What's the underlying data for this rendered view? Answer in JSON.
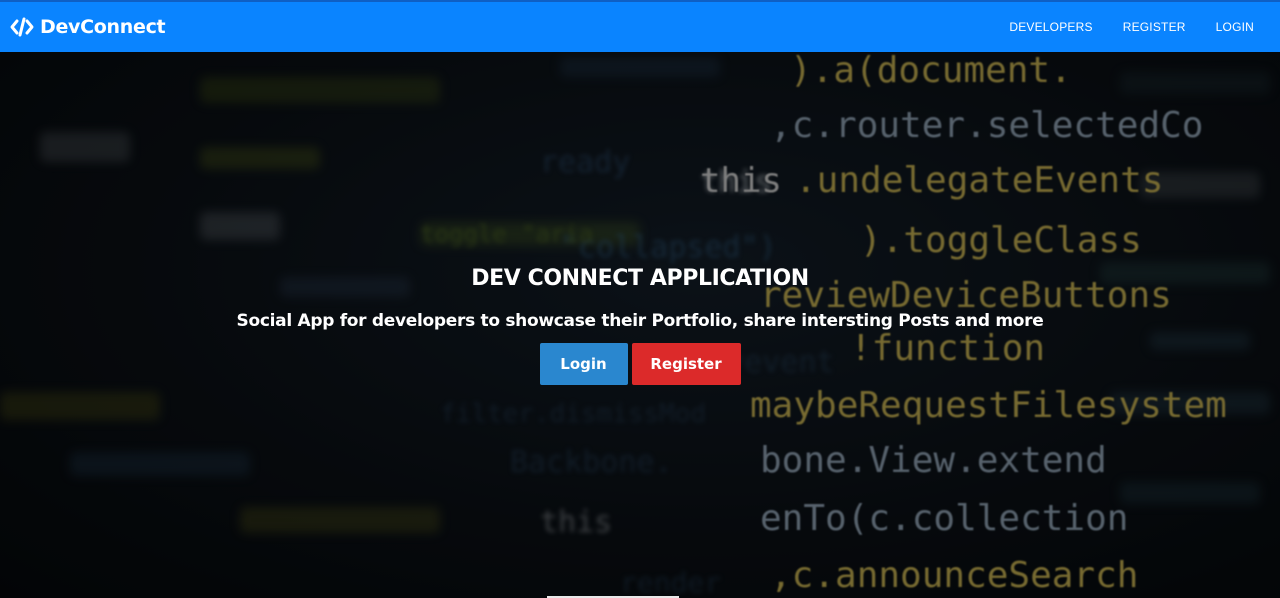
{
  "navbar": {
    "brand_icon": "code-icon",
    "brand_name": "DevConnect",
    "links": [
      "DEVELOPERS",
      "REGISTER",
      "LOGIN"
    ],
    "background_color": "#0a84ff"
  },
  "hero": {
    "title": "DEV CONNECT APPLICATION",
    "subtitle": "Social App for developers to showcase their Portfolio, share intersting Posts and more",
    "buttons": {
      "login_label": "Login",
      "register_label": "Register"
    },
    "login_color": "#2a87cf",
    "register_color": "#dc2a2a",
    "background_code_lines": [
      ").a(document.",
      ".c.router.selectedCo",
      "this.undelegateEvents",
      "psed\").toggleClass",
      "reviewDeviceButtons",
      "event!function",
      "maybeRequestFilesystem",
      "Backbone.View.extend",
      "listenTo(c.collection",
      ".c.announceSearch"
    ]
  }
}
